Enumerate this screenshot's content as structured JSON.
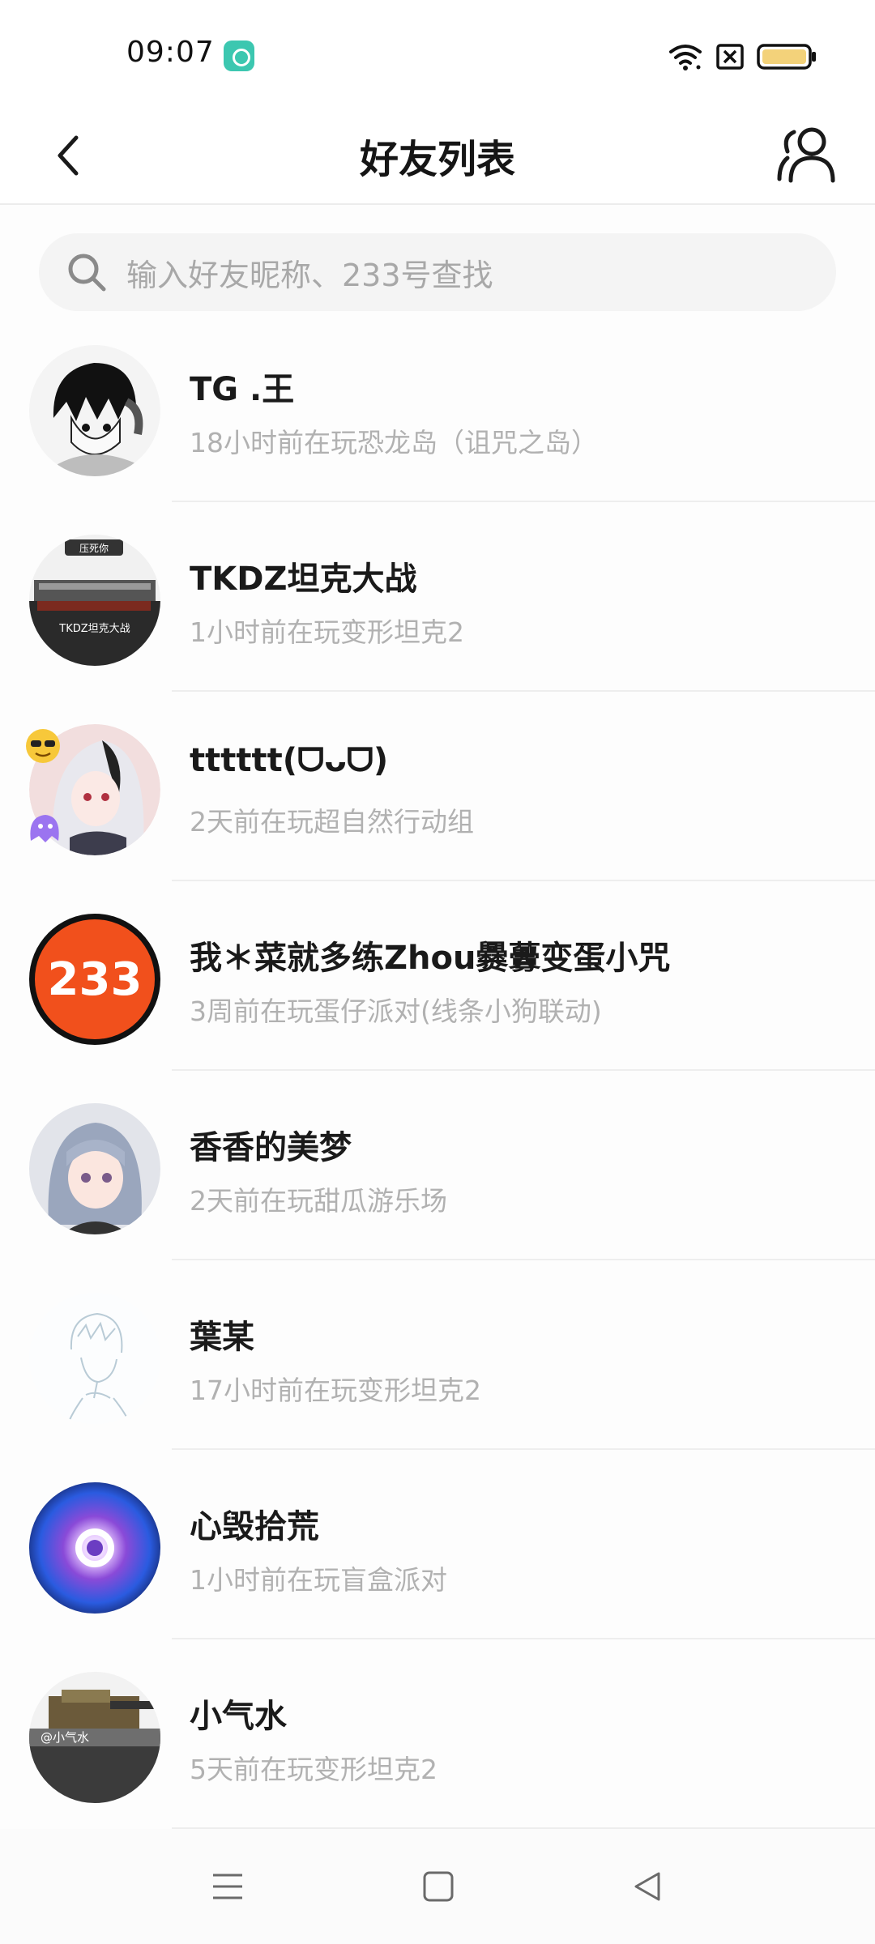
{
  "status_bar": {
    "time": "09:07"
  },
  "header": {
    "title": "好友列表"
  },
  "search": {
    "placeholder": "输入好友昵称、233号查找"
  },
  "friends": [
    {
      "name": "TG .王",
      "status": "18小时前在玩恐龙岛（诅咒之岛）",
      "avatar_label": ""
    },
    {
      "name": "TKDZ坦克大战",
      "status": "1小时前在玩变形坦克2",
      "avatar_label": "TKDZ坦克大战",
      "avatar_tag": "压死你"
    },
    {
      "name": "tttttt(ᗜᴗᗜ)",
      "status": "2天前在玩超自然行动组",
      "avatar_label": ""
    },
    {
      "name": "我＊菜就多练Zhou爨虋变蛋小咒",
      "status": "3周前在玩蛋仔派对(线条小狗联动)",
      "avatar_label": "233"
    },
    {
      "name": "香香的美梦",
      "status": "2天前在玩甜瓜游乐场",
      "avatar_label": ""
    },
    {
      "name": "葉某",
      "status": "17小时前在玩变形坦克2",
      "avatar_label": ""
    },
    {
      "name": "心毁拾荒",
      "status": "1小时前在玩盲盒派对",
      "avatar_label": ""
    },
    {
      "name": "小气水",
      "status": "5天前在玩变形坦克2",
      "avatar_label": "@小气水"
    }
  ],
  "colors": {
    "accent_app_icon": "#3cc7b0",
    "battery_fill": "#f3d27a",
    "brand_233": "#f1501c"
  },
  "icons": {
    "back": "chevron-left-icon",
    "friends": "users-icon",
    "search": "search-icon",
    "nav_menu": "menu-icon",
    "nav_home": "square-icon",
    "nav_back": "triangle-back-icon"
  }
}
